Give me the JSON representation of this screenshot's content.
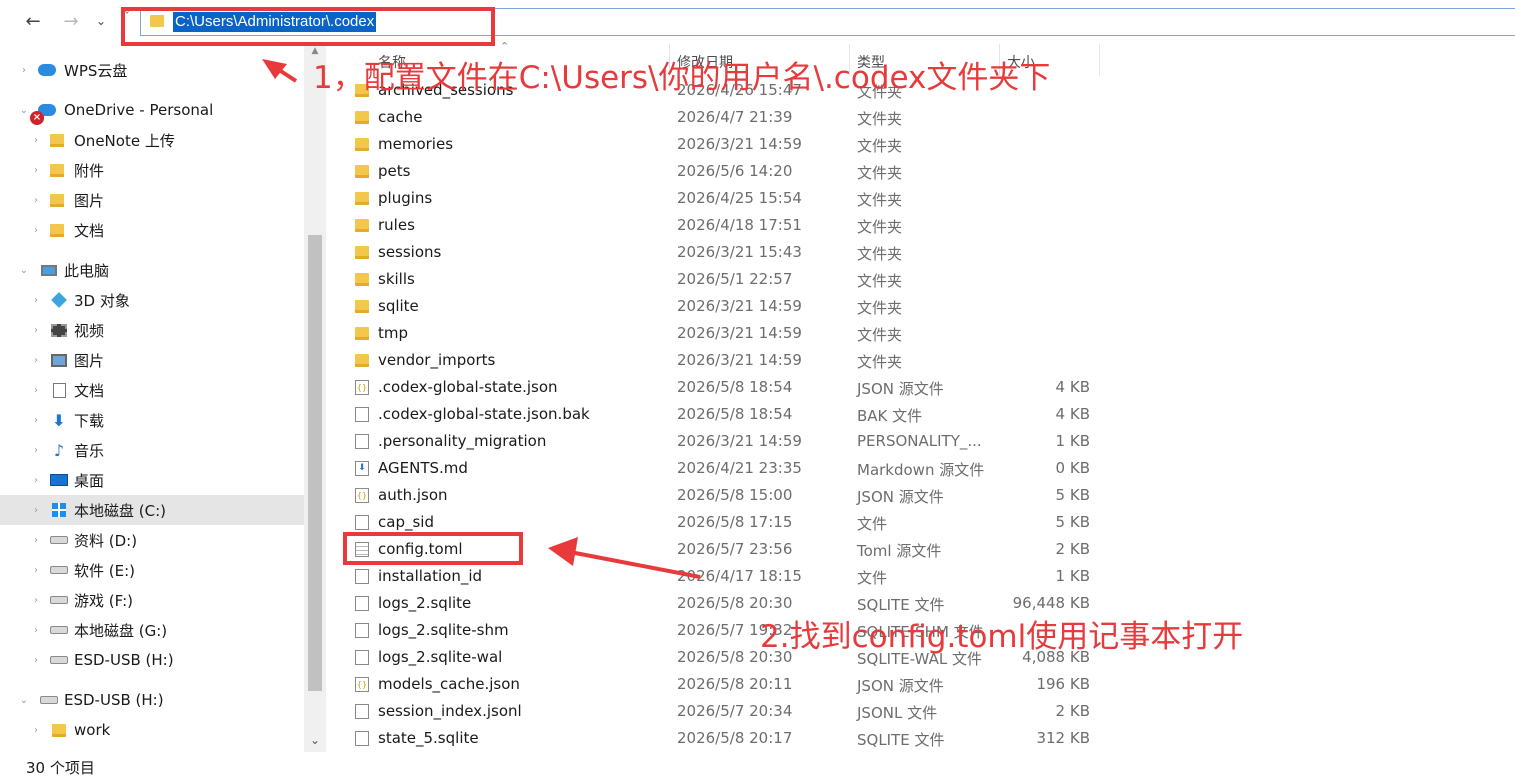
{
  "address_bar": {
    "path": "C:\\Users\\Administrator\\.codex"
  },
  "sidebar": {
    "items": [
      {
        "label": "WPS云盘",
        "icon": "cloud-icon"
      },
      {
        "label": "OneDrive - Personal",
        "icon": "onedrive-icon"
      },
      {
        "label": "OneNote 上传",
        "icon": "folder-icon"
      },
      {
        "label": "附件",
        "icon": "folder-icon"
      },
      {
        "label": "图片",
        "icon": "folder-icon"
      },
      {
        "label": "文档",
        "icon": "folder-icon"
      },
      {
        "label": "此电脑",
        "icon": "computer-icon"
      },
      {
        "label": "3D 对象",
        "icon": "3d-objects-icon"
      },
      {
        "label": "视频",
        "icon": "video-icon"
      },
      {
        "label": "图片",
        "icon": "pictures-icon"
      },
      {
        "label": "文档",
        "icon": "documents-icon"
      },
      {
        "label": "下载",
        "icon": "download-icon"
      },
      {
        "label": "音乐",
        "icon": "music-icon"
      },
      {
        "label": "桌面",
        "icon": "desktop-icon"
      },
      {
        "label": "本地磁盘 (C:)",
        "icon": "windows-drive-icon"
      },
      {
        "label": "资料 (D:)",
        "icon": "drive-icon"
      },
      {
        "label": "软件 (E:)",
        "icon": "drive-icon"
      },
      {
        "label": "游戏 (F:)",
        "icon": "drive-icon"
      },
      {
        "label": "本地磁盘 (G:)",
        "icon": "drive-icon"
      },
      {
        "label": "ESD-USB (H:)",
        "icon": "drive-icon"
      },
      {
        "label": "ESD-USB (H:)",
        "icon": "drive-icon"
      },
      {
        "label": "work",
        "icon": "folder-icon"
      }
    ]
  },
  "columns": {
    "name": "名称",
    "date": "修改日期",
    "type": "类型",
    "size": "大小"
  },
  "files": [
    {
      "name": "archived_sessions",
      "date": "2026/4/26 15:47",
      "type": "文件夹",
      "size": "",
      "icon": "folder"
    },
    {
      "name": "cache",
      "date": "2026/4/7 21:39",
      "type": "文件夹",
      "size": "",
      "icon": "folder"
    },
    {
      "name": "memories",
      "date": "2026/3/21 14:59",
      "type": "文件夹",
      "size": "",
      "icon": "folder"
    },
    {
      "name": "pets",
      "date": "2026/5/6 14:20",
      "type": "文件夹",
      "size": "",
      "icon": "folder"
    },
    {
      "name": "plugins",
      "date": "2026/4/25 15:54",
      "type": "文件夹",
      "size": "",
      "icon": "folder"
    },
    {
      "name": "rules",
      "date": "2026/4/18 17:51",
      "type": "文件夹",
      "size": "",
      "icon": "folder"
    },
    {
      "name": "sessions",
      "date": "2026/3/21 15:43",
      "type": "文件夹",
      "size": "",
      "icon": "folder"
    },
    {
      "name": "skills",
      "date": "2026/5/1 22:57",
      "type": "文件夹",
      "size": "",
      "icon": "folder"
    },
    {
      "name": "sqlite",
      "date": "2026/3/21 14:59",
      "type": "文件夹",
      "size": "",
      "icon": "folder"
    },
    {
      "name": "tmp",
      "date": "2026/3/21 14:59",
      "type": "文件夹",
      "size": "",
      "icon": "folder"
    },
    {
      "name": "vendor_imports",
      "date": "2026/3/21 14:59",
      "type": "文件夹",
      "size": "",
      "icon": "folder"
    },
    {
      "name": ".codex-global-state.json",
      "date": "2026/5/8 18:54",
      "type": "JSON 源文件",
      "size": "4 KB",
      "icon": "json"
    },
    {
      "name": ".codex-global-state.json.bak",
      "date": "2026/5/8 18:54",
      "type": "BAK 文件",
      "size": "4 KB",
      "icon": "file"
    },
    {
      "name": ".personality_migration",
      "date": "2026/3/21 14:59",
      "type": "PERSONALITY_...",
      "size": "1 KB",
      "icon": "file"
    },
    {
      "name": "AGENTS.md",
      "date": "2026/4/21 23:35",
      "type": "Markdown 源文件",
      "size": "0 KB",
      "icon": "md"
    },
    {
      "name": "auth.json",
      "date": "2026/5/8 15:00",
      "type": "JSON 源文件",
      "size": "5 KB",
      "icon": "json"
    },
    {
      "name": "cap_sid",
      "date": "2026/5/8 17:15",
      "type": "文件",
      "size": "5 KB",
      "icon": "file"
    },
    {
      "name": "config.toml",
      "date": "2026/5/7 23:56",
      "type": "Toml 源文件",
      "size": "2 KB",
      "icon": "txt"
    },
    {
      "name": "installation_id",
      "date": "2026/4/17 18:15",
      "type": "文件",
      "size": "1 KB",
      "icon": "file"
    },
    {
      "name": "logs_2.sqlite",
      "date": "2026/5/8 20:30",
      "type": "SQLITE 文件",
      "size": "96,448 KB",
      "icon": "file"
    },
    {
      "name": "logs_2.sqlite-shm",
      "date": "2026/5/7 19:32",
      "type": "SQLITE-SHM 文件",
      "size": "",
      "icon": "file"
    },
    {
      "name": "logs_2.sqlite-wal",
      "date": "2026/5/8 20:30",
      "type": "SQLITE-WAL 文件",
      "size": "4,088 KB",
      "icon": "file"
    },
    {
      "name": "models_cache.json",
      "date": "2026/5/8 20:11",
      "type": "JSON 源文件",
      "size": "196 KB",
      "icon": "json"
    },
    {
      "name": "session_index.jsonl",
      "date": "2026/5/7 20:34",
      "type": "JSONL 文件",
      "size": "2 KB",
      "icon": "file"
    },
    {
      "name": "state_5.sqlite",
      "date": "2026/5/8 20:17",
      "type": "SQLITE 文件",
      "size": "312 KB",
      "icon": "file"
    }
  ],
  "status": {
    "count": "30 个项目"
  },
  "annotations": {
    "note1": "1，配置文件在C:\\Users\\你的用户名\\.codex文件夹下",
    "note2": "2.找到config.toml使用记事本打开",
    "color": "#e8393b"
  }
}
